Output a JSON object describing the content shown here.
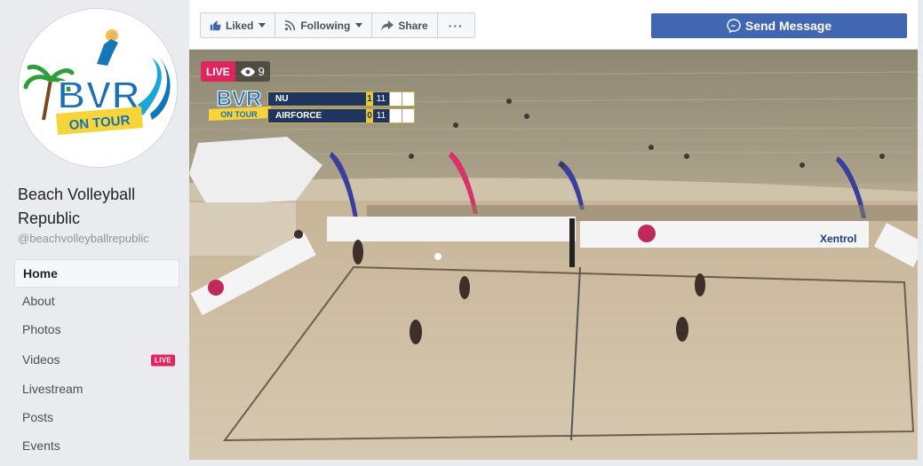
{
  "page": {
    "name": "Beach Volleyball Republic",
    "handle": "@beachvolleyballrepublic",
    "logo": {
      "main_text": "BVR",
      "banner_text": "ON TOUR"
    }
  },
  "nav": {
    "items": [
      {
        "label": "Home"
      },
      {
        "label": "About"
      },
      {
        "label": "Photos"
      },
      {
        "label": "Videos",
        "badge": "LIVE"
      },
      {
        "label": "Livestream"
      },
      {
        "label": "Posts"
      },
      {
        "label": "Events"
      }
    ]
  },
  "actions": {
    "liked_label": "Liked",
    "following_label": "Following",
    "share_label": "Share",
    "more_label": "···",
    "send_message_label": "Send Message"
  },
  "video": {
    "live_label": "LIVE",
    "viewer_count": "9",
    "overlay_logo": {
      "main_text": "BVR",
      "banner_text": "ON TOUR"
    },
    "scoreboard": [
      {
        "team": "NU",
        "sets": "1",
        "points": "11"
      },
      {
        "team": "AIRFORCE",
        "sets": "0",
        "points": "11"
      }
    ],
    "banner_texts": [
      "Xentrol"
    ]
  },
  "colors": {
    "facebook_blue": "#4267b2",
    "live_red": "#e0245e",
    "page_bg": "#e9ebee"
  }
}
